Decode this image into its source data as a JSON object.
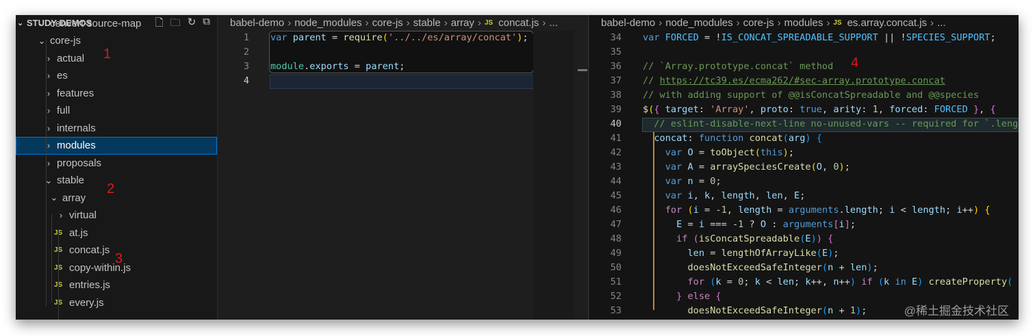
{
  "sidebar": {
    "title": "STUDY-DEMOS",
    "actions": [
      "new-file",
      "new-folder",
      "refresh",
      "collapse-all"
    ],
    "items": [
      {
        "label": "convert-source-map",
        "type": "folder",
        "open": true,
        "depth": 1
      },
      {
        "label": "core-js",
        "type": "folder",
        "open": true,
        "depth": 1
      },
      {
        "label": "actual",
        "type": "folder",
        "open": false,
        "depth": 2
      },
      {
        "label": "es",
        "type": "folder",
        "open": false,
        "depth": 2
      },
      {
        "label": "features",
        "type": "folder",
        "open": false,
        "depth": 2
      },
      {
        "label": "full",
        "type": "folder",
        "open": false,
        "depth": 2
      },
      {
        "label": "internals",
        "type": "folder",
        "open": false,
        "depth": 2
      },
      {
        "label": "modules",
        "type": "folder",
        "open": false,
        "depth": 2,
        "selected": true
      },
      {
        "label": "proposals",
        "type": "folder",
        "open": false,
        "depth": 2
      },
      {
        "label": "stable",
        "type": "folder",
        "open": true,
        "depth": 2
      },
      {
        "label": "array",
        "type": "folder",
        "open": true,
        "depth": 3
      },
      {
        "label": "virtual",
        "type": "folder",
        "open": false,
        "depth": 4
      },
      {
        "label": "at.js",
        "type": "js",
        "depth": 4
      },
      {
        "label": "concat.js",
        "type": "js",
        "depth": 4
      },
      {
        "label": "copy-within.js",
        "type": "js",
        "depth": 4
      },
      {
        "label": "entries.js",
        "type": "js",
        "depth": 4
      },
      {
        "label": "every.js",
        "type": "js",
        "depth": 4
      }
    ],
    "js_badge": "JS"
  },
  "annotations": [
    "1",
    "2",
    "3",
    "4"
  ],
  "editor1": {
    "breadcrumb": [
      "babel-demo",
      "node_modules",
      "core-js",
      "stable",
      "array",
      "concat.js",
      "..."
    ],
    "js_badge": "JS",
    "current_line": 4,
    "lines": [
      {
        "n": "1",
        "tokens": [
          [
            "var",
            "kw"
          ],
          [
            " "
          ],
          [
            "parent",
            "var"
          ],
          [
            " = "
          ],
          [
            "require",
            "fn"
          ],
          [
            "(",
            "b1"
          ],
          [
            "'../../es/array/concat'",
            "str"
          ],
          [
            ")",
            "b1"
          ],
          [
            ";"
          ]
        ]
      },
      {
        "n": "2",
        "tokens": []
      },
      {
        "n": "3",
        "tokens": [
          [
            "module",
            "mod"
          ],
          [
            "."
          ],
          [
            "exports",
            "var"
          ],
          [
            " = "
          ],
          [
            "parent",
            "var"
          ],
          [
            ";"
          ]
        ]
      },
      {
        "n": "4",
        "tokens": []
      }
    ]
  },
  "editor2": {
    "breadcrumb": [
      "babel-demo",
      "node_modules",
      "core-js",
      "modules",
      "es.array.concat.js",
      "..."
    ],
    "js_badge": "JS",
    "current_line": 40,
    "lines": [
      {
        "n": "34",
        "tokens": [
          [
            "var",
            "kw"
          ],
          [
            " "
          ],
          [
            "FORCED",
            "const"
          ],
          [
            " = !"
          ],
          [
            "IS_CONCAT_SPREADABLE_SUPPORT",
            "const"
          ],
          [
            " || !"
          ],
          [
            "SPECIES_SUPPORT",
            "const"
          ],
          [
            ";"
          ]
        ]
      },
      {
        "n": "35",
        "tokens": []
      },
      {
        "n": "36",
        "tokens": [
          [
            "// `Array.prototype.concat` method",
            "cm"
          ]
        ]
      },
      {
        "n": "37",
        "tokens": [
          [
            "// ",
            "cm"
          ],
          [
            "https://tc39.es/ecma262/#sec-array.prototype.concat",
            "link"
          ]
        ]
      },
      {
        "n": "38",
        "tokens": [
          [
            "// with adding support of @@isConcatSpreadable and @@species",
            "cm"
          ]
        ]
      },
      {
        "n": "39",
        "tokens": [
          [
            "$",
            "fn"
          ],
          [
            "(",
            "b1"
          ],
          [
            "{",
            "b2"
          ],
          [
            " "
          ],
          [
            "target",
            "var"
          ],
          [
            ": "
          ],
          [
            "'Array'",
            "str"
          ],
          [
            ", "
          ],
          [
            "proto",
            "var"
          ],
          [
            ": "
          ],
          [
            "true",
            "kw"
          ],
          [
            ", "
          ],
          [
            "arity",
            "var"
          ],
          [
            ": "
          ],
          [
            "1",
            "num"
          ],
          [
            ", "
          ],
          [
            "forced",
            "var"
          ],
          [
            ": "
          ],
          [
            "FORCED",
            "const"
          ],
          [
            " "
          ],
          [
            "}",
            "b2"
          ],
          [
            ", "
          ],
          [
            "{",
            "b2"
          ]
        ]
      },
      {
        "n": "40",
        "tokens": [
          [
            "  "
          ],
          [
            "// eslint-disable-next-line no-unused-vars -- required for `.length`",
            "cm"
          ]
        ]
      },
      {
        "n": "41",
        "tokens": [
          [
            "  "
          ],
          [
            "concat",
            "var"
          ],
          [
            ": "
          ],
          [
            "function",
            "kw"
          ],
          [
            " "
          ],
          [
            "concat",
            "fn"
          ],
          [
            "(",
            "b3"
          ],
          [
            "arg",
            "var"
          ],
          [
            ")",
            "b3"
          ],
          [
            " "
          ],
          [
            "{",
            "b3"
          ]
        ]
      },
      {
        "n": "42",
        "tokens": [
          [
            "    "
          ],
          [
            "var",
            "kw"
          ],
          [
            " "
          ],
          [
            "O",
            "var"
          ],
          [
            " = "
          ],
          [
            "toObject",
            "fn"
          ],
          [
            "(",
            "b1"
          ],
          [
            "this",
            "kw"
          ],
          [
            ")",
            "b1"
          ],
          [
            ";"
          ]
        ]
      },
      {
        "n": "43",
        "tokens": [
          [
            "    "
          ],
          [
            "var",
            "kw"
          ],
          [
            " "
          ],
          [
            "A",
            "var"
          ],
          [
            " = "
          ],
          [
            "arraySpeciesCreate",
            "fn"
          ],
          [
            "(",
            "b1"
          ],
          [
            "O",
            "var"
          ],
          [
            ", "
          ],
          [
            "0",
            "num"
          ],
          [
            ")",
            "b1"
          ],
          [
            ";"
          ]
        ]
      },
      {
        "n": "44",
        "tokens": [
          [
            "    "
          ],
          [
            "var",
            "kw"
          ],
          [
            " "
          ],
          [
            "n",
            "var"
          ],
          [
            " = "
          ],
          [
            "0",
            "num"
          ],
          [
            ";"
          ]
        ]
      },
      {
        "n": "45",
        "tokens": [
          [
            "    "
          ],
          [
            "var",
            "kw"
          ],
          [
            " "
          ],
          [
            "i",
            "var"
          ],
          [
            ", "
          ],
          [
            "k",
            "var"
          ],
          [
            ", "
          ],
          [
            "length",
            "var"
          ],
          [
            ", "
          ],
          [
            "len",
            "var"
          ],
          [
            ", "
          ],
          [
            "E",
            "var"
          ],
          [
            ";"
          ]
        ]
      },
      {
        "n": "46",
        "tokens": [
          [
            "    "
          ],
          [
            "for",
            "ctl"
          ],
          [
            " "
          ],
          [
            "(",
            "b1"
          ],
          [
            "i",
            "var"
          ],
          [
            " = -"
          ],
          [
            "1",
            "num"
          ],
          [
            ", "
          ],
          [
            "length",
            "var"
          ],
          [
            " = "
          ],
          [
            "arguments",
            "kw"
          ],
          [
            "."
          ],
          [
            "length",
            "var"
          ],
          [
            "; "
          ],
          [
            "i",
            "var"
          ],
          [
            " < "
          ],
          [
            "length",
            "var"
          ],
          [
            "; "
          ],
          [
            "i",
            "var"
          ],
          [
            "++"
          ],
          [
            ")",
            "b1"
          ],
          [
            " "
          ],
          [
            "{",
            "b1"
          ]
        ]
      },
      {
        "n": "47",
        "tokens": [
          [
            "      "
          ],
          [
            "E",
            "var"
          ],
          [
            " = "
          ],
          [
            "i",
            "var"
          ],
          [
            " === -"
          ],
          [
            "1",
            "num"
          ],
          [
            " ? "
          ],
          [
            "O",
            "var"
          ],
          [
            " : "
          ],
          [
            "arguments",
            "kw"
          ],
          [
            "[",
            "b2"
          ],
          [
            "i",
            "var"
          ],
          [
            "]",
            "b2"
          ],
          [
            ";"
          ]
        ]
      },
      {
        "n": "48",
        "tokens": [
          [
            "      "
          ],
          [
            "if",
            "ctl"
          ],
          [
            " "
          ],
          [
            "(",
            "b2"
          ],
          [
            "isConcatSpreadable",
            "fn"
          ],
          [
            "(",
            "b3"
          ],
          [
            "E",
            "var"
          ],
          [
            ")",
            "b3"
          ],
          [
            ")",
            "b2"
          ],
          [
            " "
          ],
          [
            "{",
            "b2"
          ]
        ]
      },
      {
        "n": "49",
        "tokens": [
          [
            "        "
          ],
          [
            "len",
            "var"
          ],
          [
            " = "
          ],
          [
            "lengthOfArrayLike",
            "fn"
          ],
          [
            "(",
            "b3"
          ],
          [
            "E",
            "var"
          ],
          [
            ")",
            "b3"
          ],
          [
            ";"
          ]
        ]
      },
      {
        "n": "50",
        "tokens": [
          [
            "        "
          ],
          [
            "doesNotExceedSafeInteger",
            "fn"
          ],
          [
            "(",
            "b3"
          ],
          [
            "n",
            "var"
          ],
          [
            " + "
          ],
          [
            "len",
            "var"
          ],
          [
            ")",
            "b3"
          ],
          [
            ";"
          ]
        ]
      },
      {
        "n": "51",
        "tokens": [
          [
            "        "
          ],
          [
            "for",
            "ctl"
          ],
          [
            " "
          ],
          [
            "(",
            "b3"
          ],
          [
            "k",
            "var"
          ],
          [
            " = "
          ],
          [
            "0",
            "num"
          ],
          [
            "; "
          ],
          [
            "k",
            "var"
          ],
          [
            " < "
          ],
          [
            "len",
            "var"
          ],
          [
            "; "
          ],
          [
            "k",
            "var"
          ],
          [
            "++, "
          ],
          [
            "n",
            "var"
          ],
          [
            "++"
          ],
          [
            ")",
            "b3"
          ],
          [
            " "
          ],
          [
            "if",
            "ctl"
          ],
          [
            " "
          ],
          [
            "(",
            "b3"
          ],
          [
            "k",
            "var"
          ],
          [
            " "
          ],
          [
            "in",
            "kw"
          ],
          [
            " "
          ],
          [
            "E",
            "var"
          ],
          [
            ")",
            "b3"
          ],
          [
            " "
          ],
          [
            "createProperty",
            "fn"
          ],
          [
            "(",
            "b3"
          ]
        ]
      },
      {
        "n": "52",
        "tokens": [
          [
            "      "
          ],
          [
            "}",
            "b2"
          ],
          [
            " "
          ],
          [
            "else",
            "ctl"
          ],
          [
            " "
          ],
          [
            "{",
            "b2"
          ]
        ]
      },
      {
        "n": "53",
        "tokens": [
          [
            "        "
          ],
          [
            "doesNotExceedSafeInteger",
            "fn"
          ],
          [
            "(",
            "b3"
          ],
          [
            "n",
            "var"
          ],
          [
            " + "
          ],
          [
            "1",
            "num"
          ],
          [
            ")",
            "b3"
          ],
          [
            ";"
          ]
        ]
      }
    ]
  },
  "watermark": "@稀土掘金技术社区"
}
